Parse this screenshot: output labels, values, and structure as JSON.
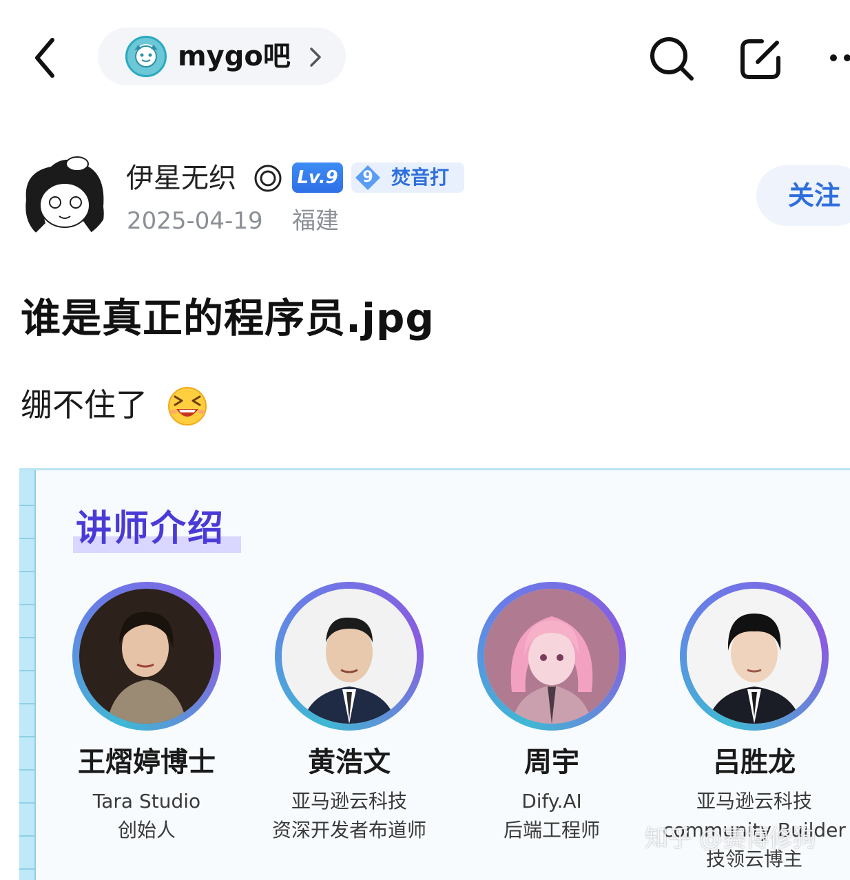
{
  "topbar": {
    "forum_name": "mygo吧"
  },
  "author": {
    "name": "伊星无织",
    "level": "Lv.9",
    "fan_level": "9",
    "fan_label": "焚音打",
    "date": "2025-04-19",
    "location": "福建",
    "follow_label": "关注"
  },
  "post": {
    "title": "谁是真正的程序员.jpg",
    "body": "绷不住了"
  },
  "embed": {
    "heading": "讲师介绍",
    "lecturers": [
      {
        "name": "王熠婷博士",
        "line1": "Tara Studio",
        "line2": "创始人",
        "line3": ""
      },
      {
        "name": "黄浩文",
        "line1": "亚马逊云科技",
        "line2": "资深开发者布道师",
        "line3": ""
      },
      {
        "name": "周宇",
        "line1": "Dify.AI",
        "line2": "后端工程师",
        "line3": ""
      },
      {
        "name": "吕胜龙",
        "line1": "亚马逊云科技",
        "line2": "community Builder",
        "line3": "技领云博主"
      }
    ]
  },
  "watermark": "知乎 @赛博修狗",
  "icons": {
    "back": "chevron-left-icon",
    "forum_chevron": "chevron-right-icon",
    "search": "search-icon",
    "edit": "edit-icon",
    "more": "more-icon",
    "verified": "verified-ring-icon",
    "fan_diamond": "diamond-icon",
    "emoji": "grinning-squint-emoji-icon"
  },
  "colors": {
    "accent_blue": "#2f6fdc",
    "level_badge": "#3d8cf5",
    "heading_purple": "#4b3bd6",
    "muted_text": "#8b8f96"
  }
}
